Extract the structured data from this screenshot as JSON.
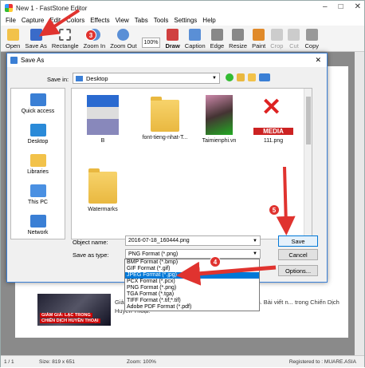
{
  "window": {
    "title": "New 1 - FastStone Editor",
    "min": "–",
    "max": "□",
    "close": "✕"
  },
  "menu": [
    "File",
    "Capture",
    "Edit",
    "Colors",
    "Effects",
    "View",
    "Tabs",
    "Tools",
    "Settings",
    "Help"
  ],
  "toolbar": [
    {
      "label": "Open",
      "color": "#f2c24a"
    },
    {
      "label": "Save As",
      "color": "#3a6bc9"
    },
    {
      "label": "Rectangle",
      "color": "#888"
    },
    {
      "label": "Zoom In",
      "color": "#5a8fd6"
    },
    {
      "label": "Zoom Out",
      "color": "#5a8fd6"
    },
    {
      "label": "100%",
      "color": "#fff"
    },
    {
      "label": "Draw",
      "color": "#d04040"
    },
    {
      "label": "Caption",
      "color": "#5a8fd6"
    },
    {
      "label": "Edge",
      "color": "#888"
    },
    {
      "label": "Resize",
      "color": "#888"
    },
    {
      "label": "Paint",
      "color": "#e08a2a"
    },
    {
      "label": "Crop",
      "color": "#bbb"
    },
    {
      "label": "Cut",
      "color": "#bbb"
    },
    {
      "label": "Copy",
      "color": "#888"
    }
  ],
  "dialog": {
    "title": "Save As",
    "save_in_label": "Save in:",
    "save_in_value": "Desktop",
    "places": [
      {
        "label": "Quick access",
        "color": "#3a7fd5"
      },
      {
        "label": "Desktop",
        "color": "#2a8ad8"
      },
      {
        "label": "Libraries",
        "color": "#f2c24a"
      },
      {
        "label": "This PC",
        "color": "#4a90e2"
      },
      {
        "label": "Network",
        "color": "#3a7fd5"
      }
    ],
    "files": [
      {
        "name": "B",
        "kind": "image"
      },
      {
        "name": "font-tieng-nhat-T...",
        "kind": "folder"
      },
      {
        "name": "Taimienphi.vn",
        "kind": "photo"
      },
      {
        "name": "111.png",
        "kind": "logo"
      },
      {
        "name": "Watermarks",
        "kind": "folder"
      }
    ],
    "logo_text": "MEDIA",
    "object_name_label": "Object name:",
    "object_name_value": "2016-07-18_160444.png",
    "save_type_label": "Save as type:",
    "save_type_value": "PNG Format (*.png)",
    "save_button": "Save",
    "cancel_button": "Cancel",
    "options_button": "Options...",
    "type_options": [
      "BMP Format (*.bmp)",
      "GIF Format (*.gif)",
      "JPEG Format (*.jpg)",
      "PCX Format (*.pcx)",
      "PNG Format (*.png)",
      "TGA Format (*.tga)",
      "TIFF Format (*.tif;*.tif)",
      "Adobe PDF Format (*.pdf)"
    ],
    "selected_index": 2
  },
  "doc": {
    "text": "Giảm giá ... game bắn súng tuyệt hay ... thủ băn khoăn. Bài viết n... trong Chiến Dịch Huyền Thoại.",
    "image_caption1": "GIẢM GIÁ: LẠC TRONG",
    "image_caption2": "CHIẾN DỊCH HUYỀN THOẠI"
  },
  "callouts": [
    "3",
    "4",
    "5"
  ],
  "status": {
    "page": "1 / 1",
    "size": "Size: 819 x 651",
    "zoom": "Zoom: 100%",
    "registered": "Registered to : MUARE.ASIA"
  }
}
